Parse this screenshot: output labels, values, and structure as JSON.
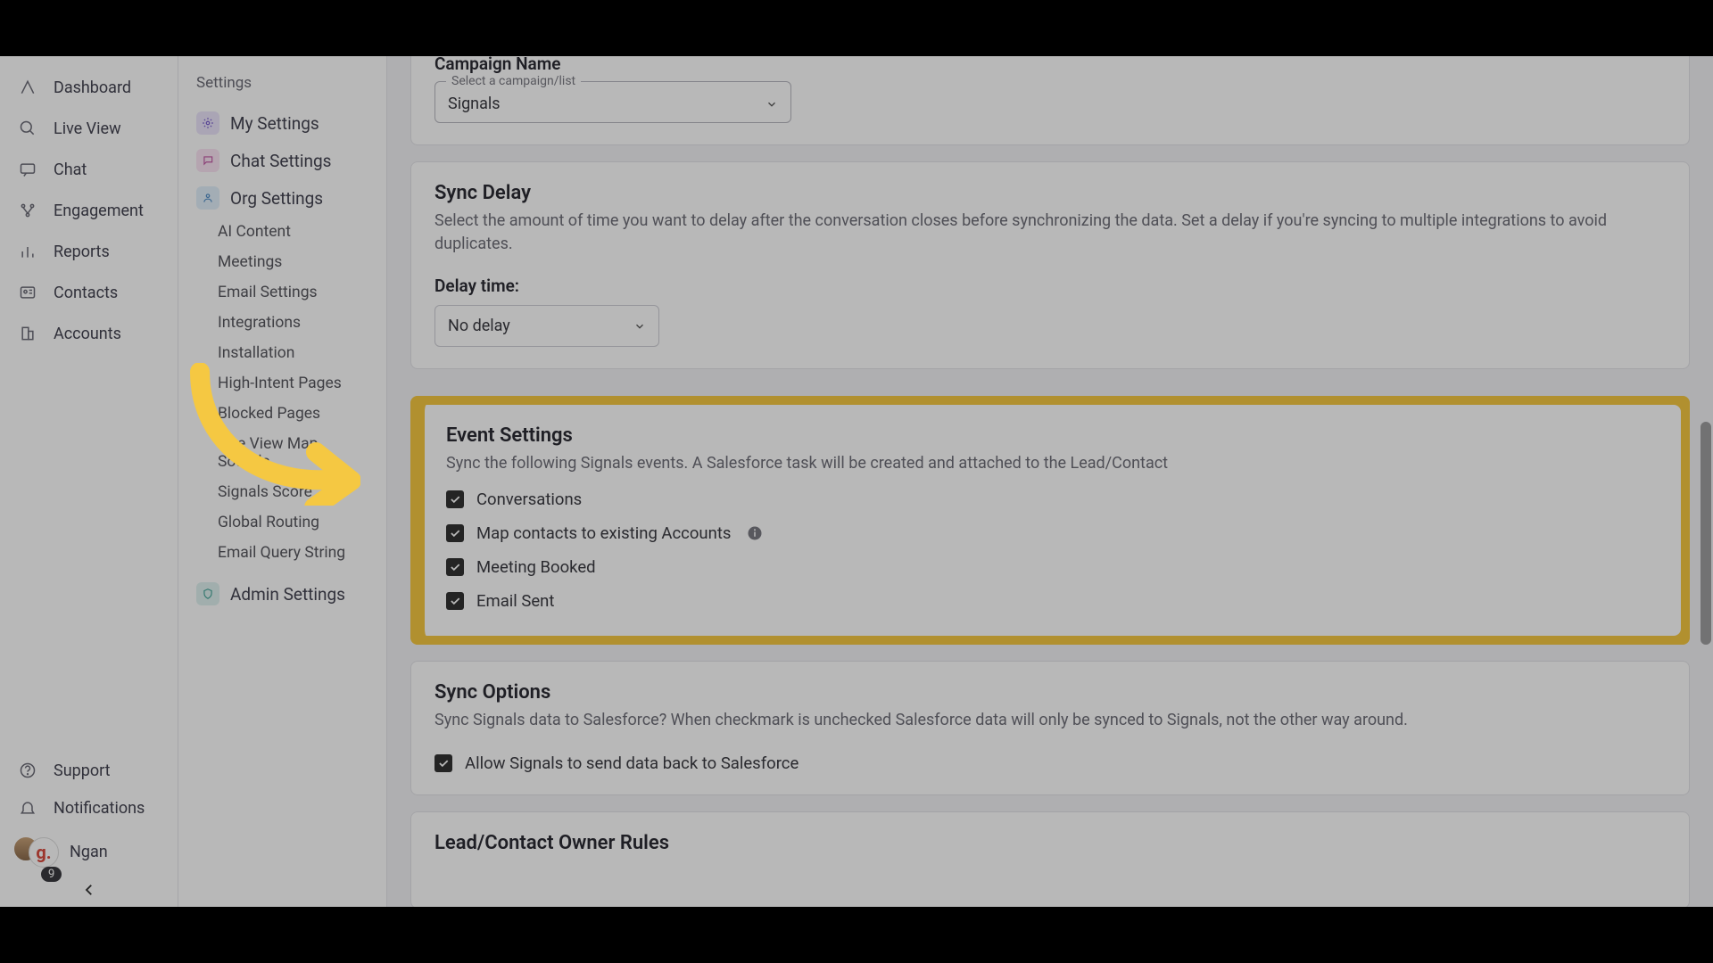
{
  "navPrimary": {
    "items": [
      {
        "label": "Dashboard"
      },
      {
        "label": "Live View"
      },
      {
        "label": "Chat"
      },
      {
        "label": "Engagement"
      },
      {
        "label": "Reports"
      },
      {
        "label": "Contacts"
      },
      {
        "label": "Accounts"
      }
    ],
    "support": "Support",
    "notifications": "Notifications",
    "userName": "Ngan",
    "userBadge": "9",
    "avatarInitial": "g."
  },
  "navSettings": {
    "header": "Settings",
    "categories": [
      {
        "label": "My Settings"
      },
      {
        "label": "Chat Settings"
      },
      {
        "label": "Org Settings"
      }
    ],
    "orgSubs": [
      "AI Content",
      "Meetings",
      "Email Settings",
      "Integrations",
      "Installation",
      "High-Intent Pages",
      "Blocked Pages",
      "Live View Map Sounds",
      "Signals Score",
      "Global Routing",
      "Email Query String"
    ],
    "adminLabel": "Admin Settings"
  },
  "campaign": {
    "fieldLabel": "Campaign Name",
    "floatLabel": "Select a campaign/list",
    "value": "Signals"
  },
  "syncDelay": {
    "title": "Sync Delay",
    "desc": "Select the amount of time you want to delay after the conversation closes before synchronizing the data. Set a delay if you're syncing to multiple integrations to avoid duplicates.",
    "delayLabel": "Delay time:",
    "delayValue": "No delay"
  },
  "eventSettings": {
    "title": "Event Settings",
    "desc": "Sync the following Signals events. A Salesforce task will be created and attached to the Lead/Contact",
    "items": [
      {
        "label": "Conversations",
        "checked": true
      },
      {
        "label": "Map contacts to existing Accounts",
        "checked": true,
        "info": true
      },
      {
        "label": "Meeting Booked",
        "checked": true
      },
      {
        "label": "Email Sent",
        "checked": true
      }
    ]
  },
  "syncOptions": {
    "title": "Sync Options",
    "desc": "Sync Signals data to Salesforce? When checkmark is unchecked Salesforce data will only be synced to Signals, not the other way around.",
    "checkLabel": "Allow Signals to send data back to Salesforce"
  },
  "leadOwner": {
    "title": "Lead/Contact Owner Rules"
  },
  "colors": {
    "highlight": "#f5c842"
  }
}
